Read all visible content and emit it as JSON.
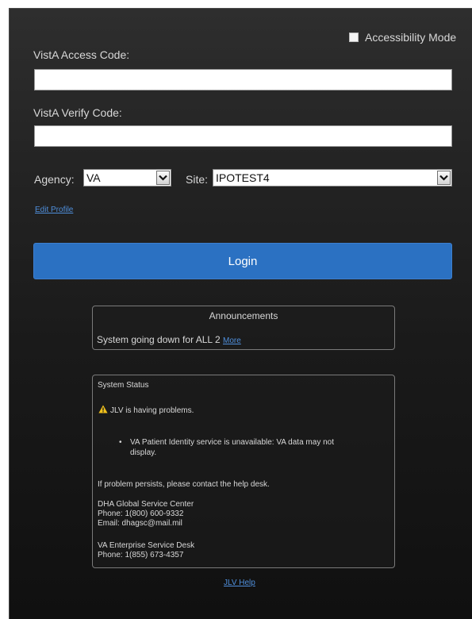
{
  "accessibility": {
    "label": "Accessibility Mode",
    "checked": false
  },
  "access_code": {
    "label": "VistA Access Code:",
    "value": ""
  },
  "verify_code": {
    "label": "VistA Verify Code:",
    "value": ""
  },
  "agency": {
    "label": "Agency:",
    "value": "VA"
  },
  "site": {
    "label": "Site:",
    "value": "IPOTEST4"
  },
  "edit_profile": "Edit Profile",
  "login_label": "Login",
  "announcements": {
    "title": "Announcements",
    "message": "System going down for ALL 2",
    "more_link": "More"
  },
  "system_status": {
    "title": "System Status",
    "alert": "JLV is having problems.",
    "bullet_1": "VA Patient Identity service is unavailable: VA data may not",
    "bullet_2": "display.",
    "persist": "If problem persists, please contact the help desk.",
    "dha_name": "DHA Global Service Center",
    "dha_phone": "Phone: 1(800) 600-9332",
    "dha_email": "Email: dhagsc@mail.mil",
    "va_name": "VA Enterprise Service Desk",
    "va_phone": "Phone: 1(855) 673-4357"
  },
  "help_link": "JLV Help",
  "icons": {
    "warning": "warning-icon",
    "dropdown": "chevron-down-icon"
  },
  "colors": {
    "accent": "#2b71c2",
    "link": "#4f8fdc",
    "warning": "#f2c21b"
  }
}
